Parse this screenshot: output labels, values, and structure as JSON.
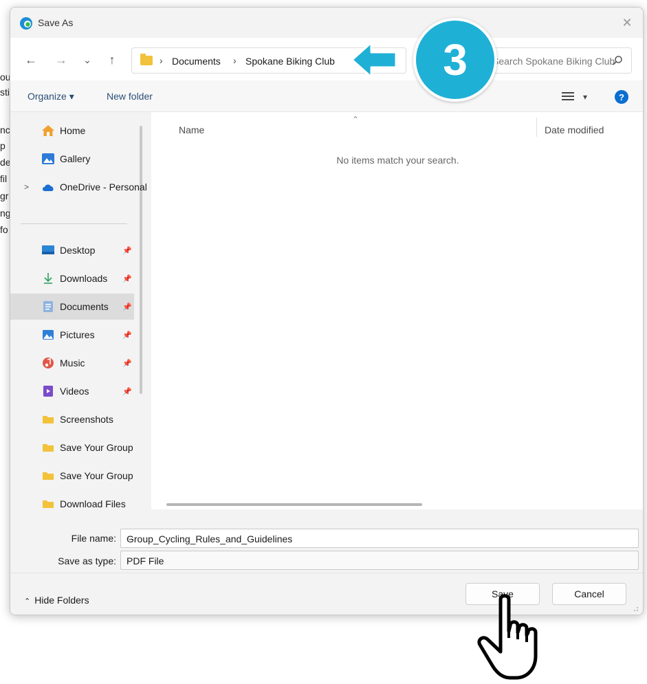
{
  "background_fragments": [
    "ou",
    "sti",
    "nc",
    "p",
    "de",
    "fil",
    "gr",
    "ng",
    "fo"
  ],
  "window": {
    "title": "Save As",
    "close_symbol": "✕"
  },
  "nav": {
    "back": "←",
    "forward": "→",
    "recent": "⌄",
    "up": "↑",
    "breadcrumb": [
      "Documents",
      "Spokane Biking Club"
    ],
    "search_placeholder": "Search Spokane Biking Club"
  },
  "toolbar": {
    "organize": "Organize ▾",
    "new_folder": "New folder",
    "view_menu": "▾",
    "help": "?"
  },
  "sidebar": {
    "top_items": [
      {
        "label": "Home",
        "icon": "home-icon"
      },
      {
        "label": "Gallery",
        "icon": "gallery-icon"
      },
      {
        "label": "OneDrive - Personal",
        "icon": "onedrive-icon",
        "expand": ">"
      }
    ],
    "pinned_items": [
      {
        "label": "Desktop",
        "icon": "desktop-icon",
        "pinned": true
      },
      {
        "label": "Downloads",
        "icon": "download-icon",
        "pinned": true
      },
      {
        "label": "Documents",
        "icon": "documents-icon",
        "pinned": true,
        "selected": true
      },
      {
        "label": "Pictures",
        "icon": "pictures-icon",
        "pinned": true
      },
      {
        "label": "Music",
        "icon": "music-icon",
        "pinned": true
      },
      {
        "label": "Videos",
        "icon": "videos-icon",
        "pinned": true
      },
      {
        "label": "Screenshots",
        "icon": "folder-icon"
      },
      {
        "label": "Save Your Group",
        "icon": "folder-icon"
      },
      {
        "label": "Save Your Group",
        "icon": "folder-icon"
      },
      {
        "label": "Download Files",
        "icon": "folder-icon"
      }
    ]
  },
  "content": {
    "columns": [
      "Name",
      "Date modified"
    ],
    "empty_message": "No items match your search."
  },
  "form": {
    "file_name_label": "File name:",
    "file_name_value": "Group_Cycling_Rules_and_Guidelines",
    "save_as_type_label": "Save as type:",
    "save_as_type_value": "PDF File",
    "hide_folders": "Hide Folders",
    "save": "Save",
    "cancel": "Cancel"
  },
  "overlay": {
    "step_number": "3",
    "arrow_color": "#1fb0d6"
  },
  "colors": {
    "accent": "#0a6fd1",
    "badge": "#1fb0d6",
    "folder": "#f2c23a"
  }
}
